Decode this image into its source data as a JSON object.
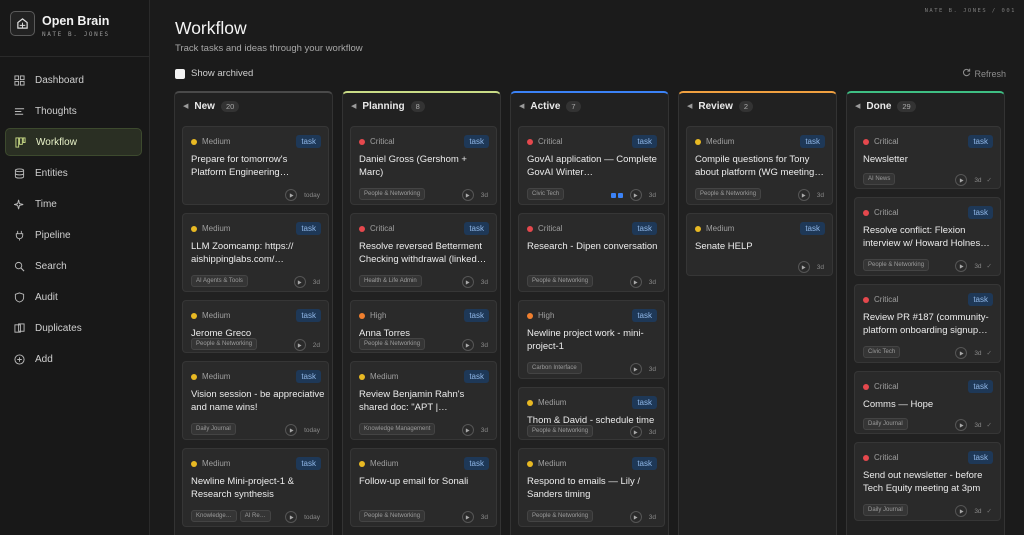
{
  "app": {
    "name": "Open Brain",
    "user_label": "NATE B. JONES"
  },
  "user_tag": "NATE B. JONES / 001",
  "sidebar": {
    "items": [
      {
        "label": "Dashboard",
        "icon": "dashboard-icon"
      },
      {
        "label": "Thoughts",
        "icon": "thoughts-icon"
      },
      {
        "label": "Workflow",
        "icon": "workflow-icon",
        "active": true
      },
      {
        "label": "Entities",
        "icon": "database-icon"
      },
      {
        "label": "Time",
        "icon": "sparkle-icon"
      },
      {
        "label": "Pipeline",
        "icon": "plug-icon"
      },
      {
        "label": "Search",
        "icon": "search-icon"
      },
      {
        "label": "Audit",
        "icon": "shield-icon"
      },
      {
        "label": "Duplicates",
        "icon": "duplicates-icon"
      },
      {
        "label": "Add",
        "icon": "plus-circle-icon"
      }
    ]
  },
  "header": {
    "title": "Workflow",
    "subtitle": "Track tasks and ideas through your workflow",
    "show_archived_label": "Show archived",
    "refresh_label": "Refresh"
  },
  "colors": {
    "critical": "#e5484d",
    "high": "#f07f2e",
    "medium": "#e8b923",
    "new": "#4a4a4a",
    "planning": "#c9db86",
    "active": "#3b82f6",
    "review": "#f0a040",
    "done": "#3fbf84"
  },
  "columns": [
    {
      "title": "New",
      "count": "20",
      "cards": [
        {
          "priority": "Medium",
          "type": "task",
          "title": "Prepare for tomorrow's Platform Engineering…",
          "tags": [],
          "age": "today"
        },
        {
          "priority": "Medium",
          "type": "task",
          "title": "LLM Zoomcamp: https:// aishippinglabs.com/…",
          "tags": [
            "AI Agents & Tools"
          ],
          "age": "3d"
        },
        {
          "priority": "Medium",
          "type": "task",
          "title": "Jerome Greco",
          "tags": [
            "People & Networking"
          ],
          "age": "2d"
        },
        {
          "priority": "Medium",
          "type": "task",
          "title": "Vision session - be appreciative and name wins!",
          "tags": [
            "Daily Journal"
          ],
          "age": "today"
        },
        {
          "priority": "Medium",
          "type": "task",
          "title": "Newline Mini-project-1 & Research synthesis",
          "tags": [
            "Knowledge…",
            "AI Re…"
          ],
          "age": "today"
        }
      ]
    },
    {
      "title": "Planning",
      "count": "8",
      "cards": [
        {
          "priority": "Critical",
          "type": "task",
          "title": "Daniel Gross (Gershom + Marc)",
          "tags": [
            "People & Networking"
          ],
          "age": "3d"
        },
        {
          "priority": "Critical",
          "type": "task",
          "title": "Resolve reversed Betterment Checking withdrawal (linked…",
          "tags": [
            "Health & Life Admin"
          ],
          "age": "3d"
        },
        {
          "priority": "High",
          "type": "task",
          "title": "Anna Torres",
          "tags": [
            "People & Networking"
          ],
          "age": "3d"
        },
        {
          "priority": "Medium",
          "type": "task",
          "title": "Review Benjamin Rahn's shared doc: \"APT |…",
          "tags": [
            "Knowledge Management"
          ],
          "age": "3d"
        },
        {
          "priority": "Medium",
          "type": "task",
          "title": "Follow-up email for Sonali",
          "tags": [
            "People & Networking"
          ],
          "age": "3d"
        }
      ]
    },
    {
      "title": "Active",
      "count": "7",
      "cards": [
        {
          "priority": "Critical",
          "type": "task",
          "title": "GovAI application — Complete GovAI Winter…",
          "tags": [
            "Civic Tech"
          ],
          "age": "3d",
          "progress": true
        },
        {
          "priority": "Critical",
          "type": "task",
          "title": "Research - Dipen conversation",
          "tags": [
            "People & Networking"
          ],
          "age": "3d"
        },
        {
          "priority": "High",
          "type": "task",
          "title": "Newline project work - mini-project-1",
          "tags": [
            "Carbon Interface"
          ],
          "age": "3d"
        },
        {
          "priority": "Medium",
          "type": "task",
          "title": "Thom & David - schedule time",
          "tags": [
            "People & Networking"
          ],
          "age": "3d"
        },
        {
          "priority": "Medium",
          "type": "task",
          "title": "Respond to emails — Lily / Sanders timing",
          "tags": [
            "People & Networking"
          ],
          "age": "3d"
        }
      ]
    },
    {
      "title": "Review",
      "count": "2",
      "cards": [
        {
          "priority": "Medium",
          "type": "task",
          "title": "Compile questions for Tony about platform (WG meeting…",
          "tags": [
            "People & Networking"
          ],
          "age": "3d"
        },
        {
          "priority": "Medium",
          "type": "task",
          "title": "Senate HELP",
          "tags": [],
          "age": "3d"
        }
      ]
    },
    {
      "title": "Done",
      "count": "29",
      "cards": [
        {
          "priority": "Critical",
          "type": "task",
          "title": "Newsletter",
          "tags": [
            "AI News"
          ],
          "age": "3d",
          "done": true
        },
        {
          "priority": "Critical",
          "type": "task",
          "title": "Resolve conflict: Flexion interview w/ Howard Holnes…",
          "tags": [
            "People & Networking"
          ],
          "age": "3d",
          "done": true
        },
        {
          "priority": "Critical",
          "type": "task",
          "title": "Review PR #187 (community-platform onboarding signup…",
          "tags": [
            "Civic Tech"
          ],
          "age": "3d",
          "done": true
        },
        {
          "priority": "Critical",
          "type": "task",
          "title": "Comms — Hope",
          "tags": [
            "Daily Journal"
          ],
          "age": "3d",
          "done": true
        },
        {
          "priority": "Critical",
          "type": "task",
          "title": "Send out newsletter - before Tech Equity meeting at 3pm",
          "tags": [
            "Daily Journal"
          ],
          "age": "3d",
          "done": true
        }
      ]
    }
  ]
}
